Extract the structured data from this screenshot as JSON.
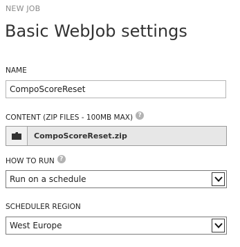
{
  "header": {
    "eyebrow": "NEW JOB",
    "title": "Basic WebJob settings"
  },
  "fields": {
    "name": {
      "label": "NAME",
      "value": "CompoScoreReset"
    },
    "content": {
      "label": "CONTENT (ZIP FILES - 100MB MAX)",
      "file_name": "CompoScoreReset.zip",
      "button_icon": "folder-icon"
    },
    "how_to_run": {
      "label": "HOW TO RUN",
      "selected": "Run on a schedule"
    },
    "scheduler_region": {
      "label": "SCHEDULER REGION",
      "selected": "West Europe"
    },
    "help_glyph": "?"
  }
}
